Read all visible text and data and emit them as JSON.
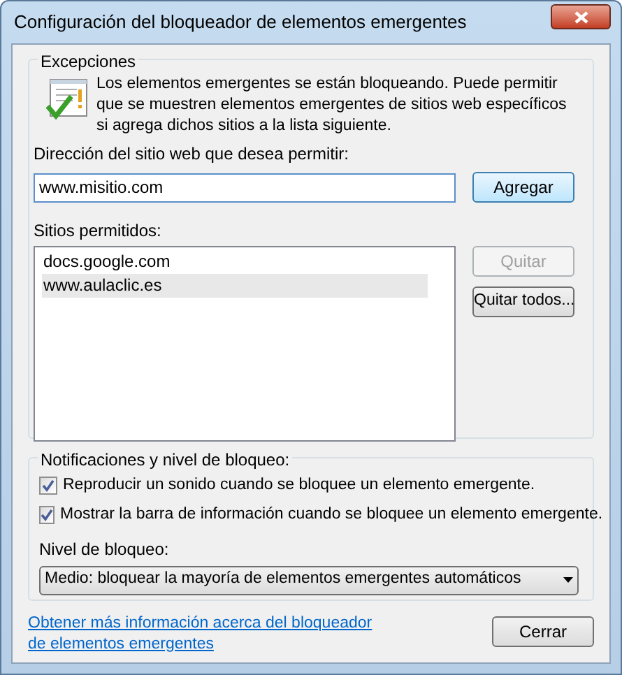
{
  "window": {
    "title": "Configuración del bloqueador de elementos emergentes"
  },
  "exceptions": {
    "legend": "Excepciones",
    "message": "Los elementos emergentes se están bloqueando. Puede permitir que se muestren elementos emergentes de sitios web específicos si agrega dichos sitios a la lista siguiente.",
    "address_label": "Dirección del sitio web que desea permitir:",
    "address_value": "www.misitio.com",
    "add_button": "Agregar",
    "list_label": "Sitios permitidos:",
    "sites": [
      {
        "label": "docs.google.com",
        "selected": false
      },
      {
        "label": "www.aulaclic.es",
        "selected": true
      }
    ],
    "remove_button": {
      "label": "Quitar",
      "disabled": true
    },
    "remove_all_button": {
      "label": "Quitar todos...",
      "disabled": false
    }
  },
  "notifications": {
    "legend": "Notificaciones y nivel de bloqueo:",
    "options": [
      {
        "label": "Reproducir un sonido cuando se bloquee un elemento emergente.",
        "checked": true
      },
      {
        "label": "Mostrar la barra de información cuando se bloquee un elemento emergente.",
        "checked": true
      }
    ],
    "level_label": "Nivel de bloqueo:",
    "level_value": "Medio: bloquear la mayoría de elementos emergentes automáticos"
  },
  "footer": {
    "link": "Obtener más información acerca del bloqueador de elementos emergentes",
    "close_button": "Cerrar"
  }
}
